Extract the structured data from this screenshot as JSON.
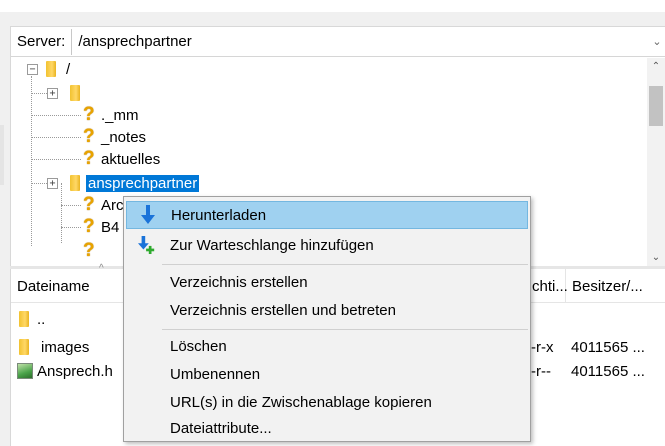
{
  "server": {
    "label": "Server:",
    "path": "/ansprechpartner"
  },
  "tree": {
    "root_label": "/",
    "items": [
      {
        "label": ""
      },
      {
        "label": "._mm"
      },
      {
        "label": "_notes"
      },
      {
        "label": "aktuelles"
      },
      {
        "label": "ansprechpartner"
      },
      {
        "label": "Arc"
      },
      {
        "label": "B4"
      }
    ]
  },
  "files": {
    "headers": {
      "name": "Dateiname",
      "perms": "chti...",
      "owner": "Besitzer/..."
    },
    "rows": [
      {
        "name": "..",
        "perms": "",
        "owner": ""
      },
      {
        "name": "images",
        "perms": "--r-x",
        "owner": "4011565 ..."
      },
      {
        "name": "Ansprech.h",
        "perms": "--r--",
        "owner": "4011565 ..."
      }
    ]
  },
  "context_menu": {
    "items": [
      {
        "label": "Herunterladen",
        "icon": "download-arrow-icon"
      },
      {
        "label": "Zur Warteschlange hinzufügen",
        "icon": "add-to-queue-icon"
      },
      {
        "label": "Verzeichnis erstellen"
      },
      {
        "label": "Verzeichnis erstellen und betreten"
      },
      {
        "label": "Löschen"
      },
      {
        "label": "Umbenennen"
      },
      {
        "label": "URL(s) in die Zwischenablage kopieren"
      },
      {
        "label": "Dateiattribute..."
      }
    ]
  },
  "colors": {
    "selection": "#0078d7",
    "menu_highlight": "#9fd1f0",
    "download_blue": "#1a73d9"
  }
}
